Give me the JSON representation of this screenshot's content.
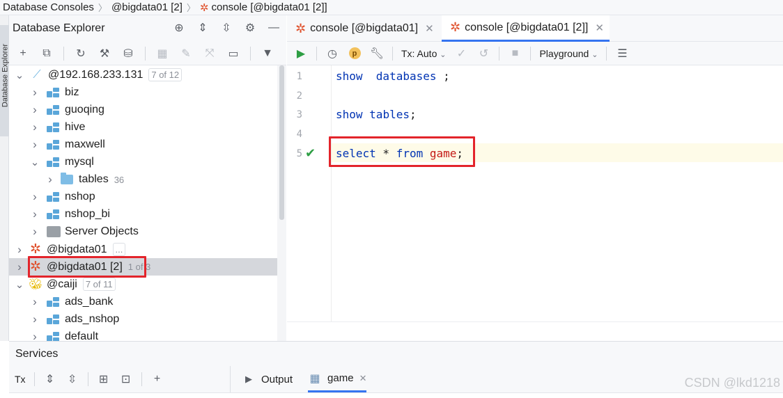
{
  "breadcrumb": [
    "Database Consoles",
    "@bigdata01 [2]",
    "console [@bigdata01 [2]]"
  ],
  "side_strip": {
    "label": "Database Explorer"
  },
  "explorer": {
    "title": "Database Explorer",
    "tree": [
      {
        "indent": 0,
        "chev": "v",
        "icon": "host",
        "label": "@192.168.233.131",
        "badge": "7 of 12"
      },
      {
        "indent": 1,
        "chev": ">",
        "icon": "schema",
        "label": "biz"
      },
      {
        "indent": 1,
        "chev": ">",
        "icon": "schema",
        "label": "guoqing"
      },
      {
        "indent": 1,
        "chev": ">",
        "icon": "schema",
        "label": "hive"
      },
      {
        "indent": 1,
        "chev": ">",
        "icon": "schema",
        "label": "maxwell"
      },
      {
        "indent": 1,
        "chev": "v",
        "icon": "schema",
        "label": "mysql"
      },
      {
        "indent": 2,
        "chev": ">",
        "icon": "folder",
        "label": "tables",
        "count": "36"
      },
      {
        "indent": 1,
        "chev": ">",
        "icon": "schema",
        "label": "nshop"
      },
      {
        "indent": 1,
        "chev": ">",
        "icon": "schema",
        "label": "nshop_bi"
      },
      {
        "indent": 1,
        "chev": ">",
        "icon": "server",
        "label": "Server Objects"
      },
      {
        "indent": 0,
        "chev": ">",
        "icon": "star",
        "label": "@bigdata01",
        "badge": "..."
      },
      {
        "indent": 0,
        "chev": ">",
        "icon": "star",
        "label": "@bigdata01 [2]",
        "count": "1 of 3",
        "selected": true
      },
      {
        "indent": 0,
        "chev": "v",
        "icon": "bee",
        "label": "@caiji",
        "badge": "7 of 11"
      },
      {
        "indent": 1,
        "chev": ">",
        "icon": "schema",
        "label": "ads_bank"
      },
      {
        "indent": 1,
        "chev": ">",
        "icon": "schema",
        "label": "ads_nshop"
      },
      {
        "indent": 1,
        "chev": ">",
        "icon": "schema",
        "label": "default"
      }
    ]
  },
  "editor": {
    "tabs": [
      {
        "label": "console [@bigdata01]",
        "active": false
      },
      {
        "label": "console [@bigdata01 [2]]",
        "active": true
      }
    ],
    "toolbar": {
      "tx_label": "Tx: Auto",
      "playground_label": "Playground"
    },
    "lines": [
      {
        "num": "1",
        "tokens": [
          [
            "kw",
            "show"
          ],
          [
            "",
            "  "
          ],
          [
            "kw",
            "databases"
          ],
          [
            "",
            " ;"
          ]
        ]
      },
      {
        "num": "2",
        "tokens": []
      },
      {
        "num": "3",
        "tokens": [
          [
            "kw",
            "show"
          ],
          [
            "",
            " "
          ],
          [
            "kw",
            "tables"
          ],
          [
            "",
            ";"
          ]
        ]
      },
      {
        "num": "4",
        "tokens": []
      },
      {
        "num": "5",
        "tokens": [
          [
            "kw",
            "select"
          ],
          [
            "",
            " * "
          ],
          [
            "kw",
            "from"
          ],
          [
            "",
            " "
          ],
          [
            "ident",
            "game"
          ],
          [
            "",
            ";"
          ]
        ],
        "status": "ok"
      }
    ]
  },
  "services": {
    "title": "Services",
    "tx_label": "Tx",
    "tabs": [
      {
        "label": "Output",
        "icon": "output-icon"
      },
      {
        "label": "game",
        "icon": "table-icon",
        "closable": true
      }
    ]
  },
  "watermark": "CSDN @lkd1218",
  "colors": {
    "accent": "#3574f0",
    "highlight_box": "#e3242b",
    "keyword": "#0033b3",
    "identifier": "#c41a16",
    "run_green": "#2e9e44",
    "star": "#e0532f"
  }
}
